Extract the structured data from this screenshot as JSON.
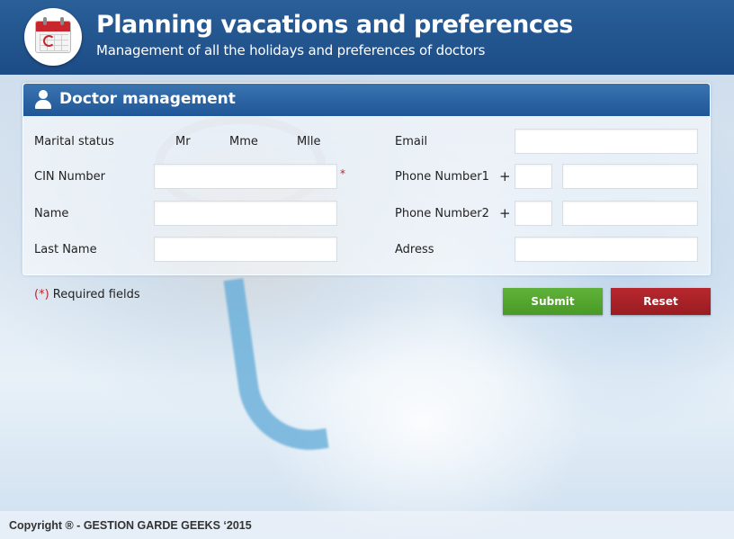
{
  "header": {
    "title": "Planning vacations and preferences",
    "subtitle": "Management of all the holidays and preferences of doctors",
    "logo_icon": "calendar-icon"
  },
  "panel": {
    "title": "Doctor management",
    "title_icon": "user-icon",
    "marital_status": {
      "label": "Marital status",
      "options": [
        "Mr",
        "Mme",
        "Mlle"
      ]
    },
    "cin": {
      "label": "CIN Number",
      "value": "",
      "required_mark": "*"
    },
    "name": {
      "label": "Name",
      "value": ""
    },
    "last_name": {
      "label": "Last Name",
      "value": ""
    },
    "email": {
      "label": "Email",
      "value": ""
    },
    "phone1": {
      "label": "Phone Number1",
      "prefix_symbol": "+",
      "code": "",
      "number": ""
    },
    "phone2": {
      "label": "Phone Number2",
      "prefix_symbol": "+",
      "code": "",
      "number": ""
    },
    "address": {
      "label": "Adress",
      "value": ""
    }
  },
  "form_footer": {
    "required_note_star": "(*)",
    "required_note_text": " Required fields",
    "submit_label": "Submit",
    "reset_label": "Reset"
  },
  "footer": {
    "copyright": "Copyright ®  - GESTION GARDE GEEKS ‘2015"
  },
  "colors": {
    "header_bg": "#1c4c86",
    "panel_header_bg": "#2a65a4",
    "submit_bg": "#54a62e",
    "reset_bg": "#a92227",
    "required_mark": "#c0262d"
  }
}
